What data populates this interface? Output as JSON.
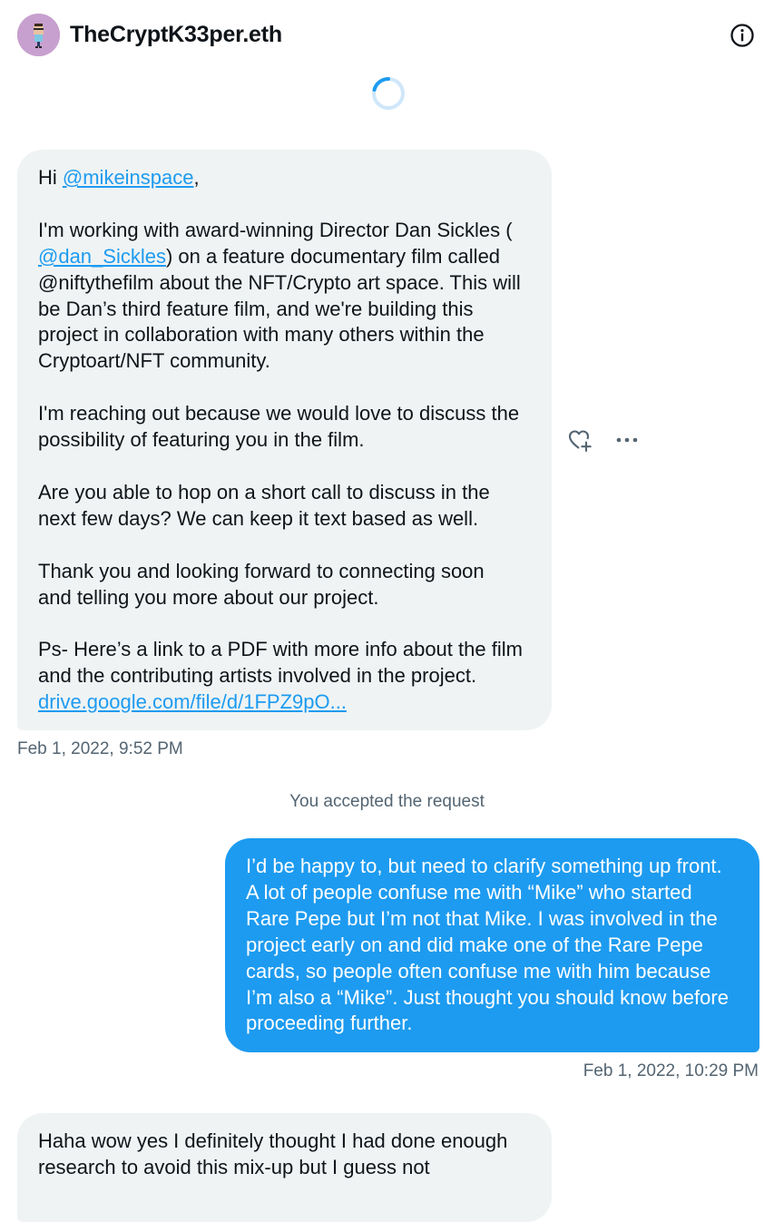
{
  "header": {
    "title": "TheCryptK33per.eth",
    "avatar_icon": "pixel-character-avatar",
    "info_icon": "info-icon"
  },
  "messages": [
    {
      "direction": "incoming",
      "greeting_prefix": "Hi ",
      "mention": "@mikeinspace",
      "greeting_suffix": ",",
      "p1_before": "I'm working with award-winning Director Dan Sickles (\n",
      "p1_link": "@dan_Sickles",
      "p1_after": ") on a feature documentary film called\n@niftythefilm about the NFT/Crypto art space. This will\nbe Dan’s third feature film, and we're building this\nproject in collaboration with many others within the\nCryptoart/NFT community.",
      "p2": "I'm reaching out because we would love to discuss the\npossibility of featuring you in the film.",
      "p3": "Are you able to hop on a short call to discuss in the\nnext few days? We can keep it text based as well.",
      "p4": "Thank you and looking forward to connecting soon\nand telling you more about our project.",
      "p5": "Ps- Here’s a link to a PDF with more info about the film\nand the contributing artists involved in the project.",
      "p5_link": "drive.google.com/file/d/1FPZ9pO...",
      "timestamp": "Feb 1, 2022, 9:52 PM"
    },
    {
      "direction": "system",
      "text": "You accepted the request"
    },
    {
      "direction": "outgoing",
      "text": "I’d be happy to, but need to clarify something up front.\nA lot of people confuse me with “Mike” who started\nRare Pepe but I’m not that Mike. I was involved in the\nproject early on and did make one of the Rare Pepe\ncards, so people often confuse me with him because\nI’m also a “Mike”. Just thought you should know before\nproceeding further.",
      "timestamp": "Feb 1, 2022, 10:29 PM"
    },
    {
      "direction": "incoming",
      "text": "Haha wow yes I definitely thought I had done enough\nresearch to avoid this mix-up but I guess not"
    }
  ],
  "message_actions": {
    "react_icon": "heart-plus-icon",
    "more_icon": "more-horizontal-icon"
  },
  "colors": {
    "accent": "#1d9bf0",
    "incoming_bubble": "#eff3f4",
    "muted_text": "#536471"
  }
}
